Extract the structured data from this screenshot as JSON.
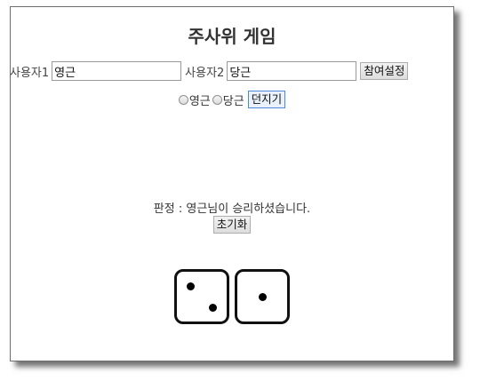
{
  "title": "주사위 게임",
  "players": {
    "label1": "사용자1",
    "value1": "영근",
    "label2": "사용자2",
    "value2": "당근",
    "join_button": "참여설정"
  },
  "turn": {
    "options": [
      "영근",
      "당근"
    ],
    "roll_button": "던지기"
  },
  "result": {
    "text": "판정 : 영근님이 승리하셨습니다.",
    "reset_button": "초기화"
  },
  "dice": [
    2,
    1
  ]
}
